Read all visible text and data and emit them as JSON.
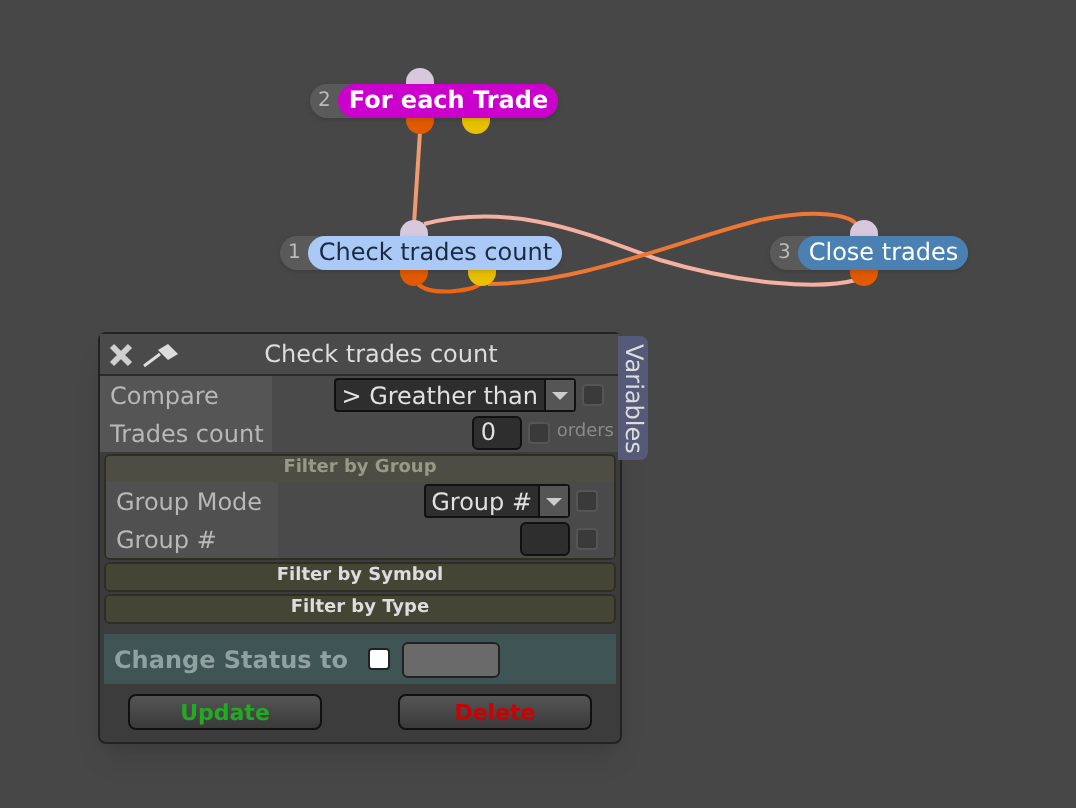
{
  "nodes": [
    {
      "number": "2",
      "label": "For each Trade",
      "color": "#cc00cc"
    },
    {
      "number": "1",
      "label": "Check trades count",
      "color": "#aac9f6"
    },
    {
      "number": "3",
      "label": "Close trades",
      "color": "#4a80b2"
    }
  ],
  "panel": {
    "title": "Check trades count",
    "side_tab": "Variables",
    "rows": [
      {
        "label": "Compare",
        "kind": "dropdown",
        "value": "> Greather than",
        "checked": false
      },
      {
        "label": "Trades count",
        "kind": "number",
        "value": "0",
        "checked": false,
        "unit": "orders"
      }
    ],
    "sections": [
      {
        "title": "Filter by Group",
        "expanded": true,
        "rows": [
          {
            "label": "Group Mode",
            "kind": "dropdown",
            "value": "Group #",
            "checked": false
          },
          {
            "label": "Group #",
            "kind": "number",
            "value": "",
            "checked": false
          }
        ]
      },
      {
        "title": "Filter by Symbol",
        "expanded": false
      },
      {
        "title": "Filter by Type",
        "expanded": false
      }
    ],
    "status": {
      "label": "Change Status to",
      "checked": false
    },
    "buttons": [
      {
        "label": "Update",
        "color": "#22aa22"
      },
      {
        "label": "Delete",
        "color": "#cc0000"
      }
    ]
  }
}
